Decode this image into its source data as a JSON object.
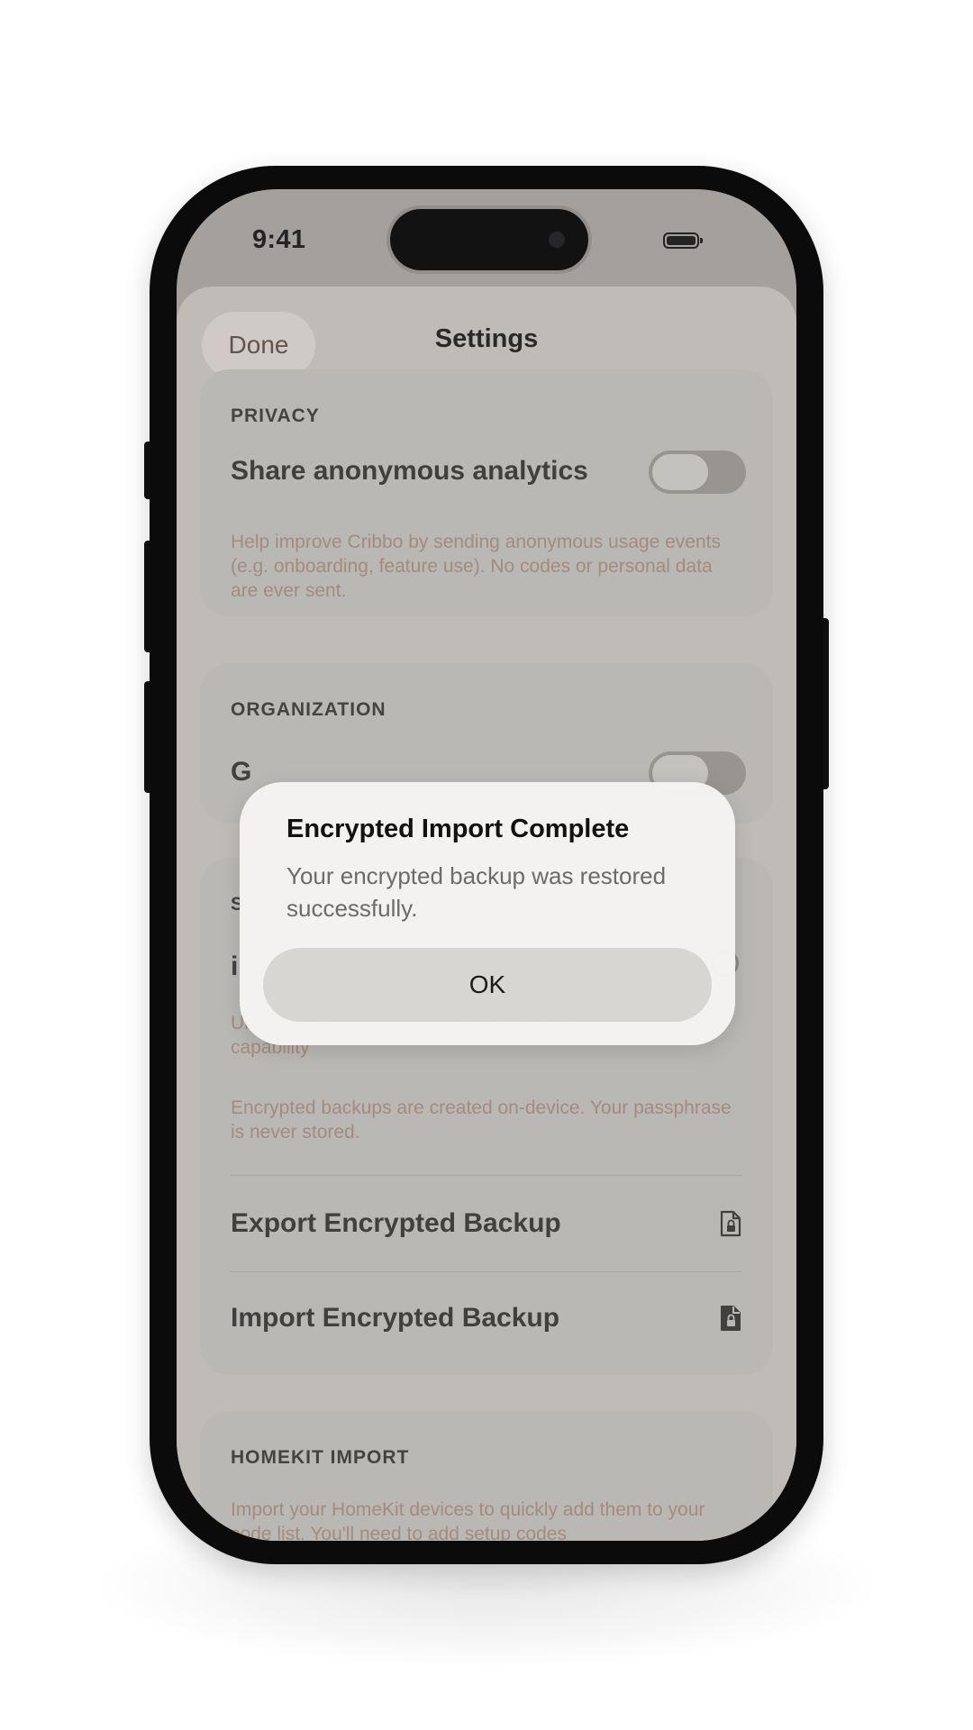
{
  "status_bar": {
    "time": "9:41"
  },
  "nav": {
    "done_label": "Done",
    "title": "Settings"
  },
  "privacy": {
    "header": "PRIVACY",
    "analytics_label": "Share anonymous analytics",
    "analytics_enabled": false,
    "footnote": "Help improve Cribbo by sending anonymous usage events (e.g. onboarding, feature use). No codes or personal data are ever sent."
  },
  "organization": {
    "header": "ORGANIZATION",
    "row_label_partial": "G"
  },
  "backup": {
    "header_partial": "S",
    "icloud_label_partial": "i",
    "unavailable_note": "Unavailable: sign in to iCloud and enable iCloud capability",
    "encryption_note": "Encrypted backups are created on-device. Your passphrase is never stored.",
    "export_label": "Export Encrypted Backup",
    "import_label": "Import Encrypted Backup"
  },
  "homekit": {
    "header": "HOMEKIT IMPORT",
    "footnote": "Import your HomeKit devices to quickly add them to your code list. You'll need to add setup codes"
  },
  "alert": {
    "title": "Encrypted Import Complete",
    "message": "Your encrypted backup was restored successfully.",
    "ok_label": "OK"
  },
  "icons": {
    "export": "document-lock-icon",
    "import": "document-lock-filled-icon"
  }
}
